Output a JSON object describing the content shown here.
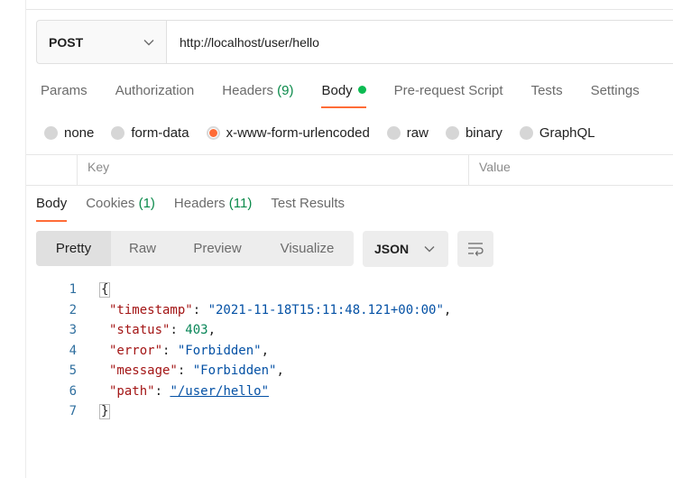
{
  "request": {
    "method": "POST",
    "url": "http://localhost/user/hello"
  },
  "request_tabs": [
    {
      "label": "Params",
      "count": ""
    },
    {
      "label": "Authorization",
      "count": ""
    },
    {
      "label": "Headers",
      "count": "(9)"
    },
    {
      "label": "Body",
      "count": ""
    },
    {
      "label": "Pre-request Script",
      "count": ""
    },
    {
      "label": "Tests",
      "count": ""
    },
    {
      "label": "Settings",
      "count": ""
    }
  ],
  "body_types": [
    "none",
    "form-data",
    "x-www-form-urlencoded",
    "raw",
    "binary",
    "GraphQL"
  ],
  "selected_body_type": "x-www-form-urlencoded",
  "kv_table": {
    "key_header": "Key",
    "value_header": "Value"
  },
  "response_tabs": [
    {
      "label": "Body",
      "count": ""
    },
    {
      "label": "Cookies",
      "count": "(1)"
    },
    {
      "label": "Headers",
      "count": "(11)"
    },
    {
      "label": "Test Results",
      "count": ""
    }
  ],
  "view_modes": [
    "Pretty",
    "Raw",
    "Preview",
    "Visualize"
  ],
  "format": "JSON",
  "response_body": {
    "line_numbers": [
      "1",
      "2",
      "3",
      "4",
      "5",
      "6",
      "7"
    ],
    "open_brace": "{",
    "close_brace": "}",
    "fields": [
      {
        "key": "\"timestamp\"",
        "value": "\"2021-11-18T15:11:48.121+00:00\"",
        "comma": ","
      },
      {
        "key": "\"status\"",
        "value": "403",
        "comma": ","
      },
      {
        "key": "\"error\"",
        "value": "\"Forbidden\"",
        "comma": ","
      },
      {
        "key": "\"message\"",
        "value": "\"Forbidden\"",
        "comma": ","
      },
      {
        "key": "\"path\"",
        "value": "\"/user/hello\"",
        "comma": ""
      }
    ]
  },
  "colors": {
    "accent": "#ff6c37",
    "success": "#0cbb52",
    "count": "#0a8a4a"
  },
  "icons": [
    "chevron-down-icon",
    "wrap-lines-icon"
  ]
}
